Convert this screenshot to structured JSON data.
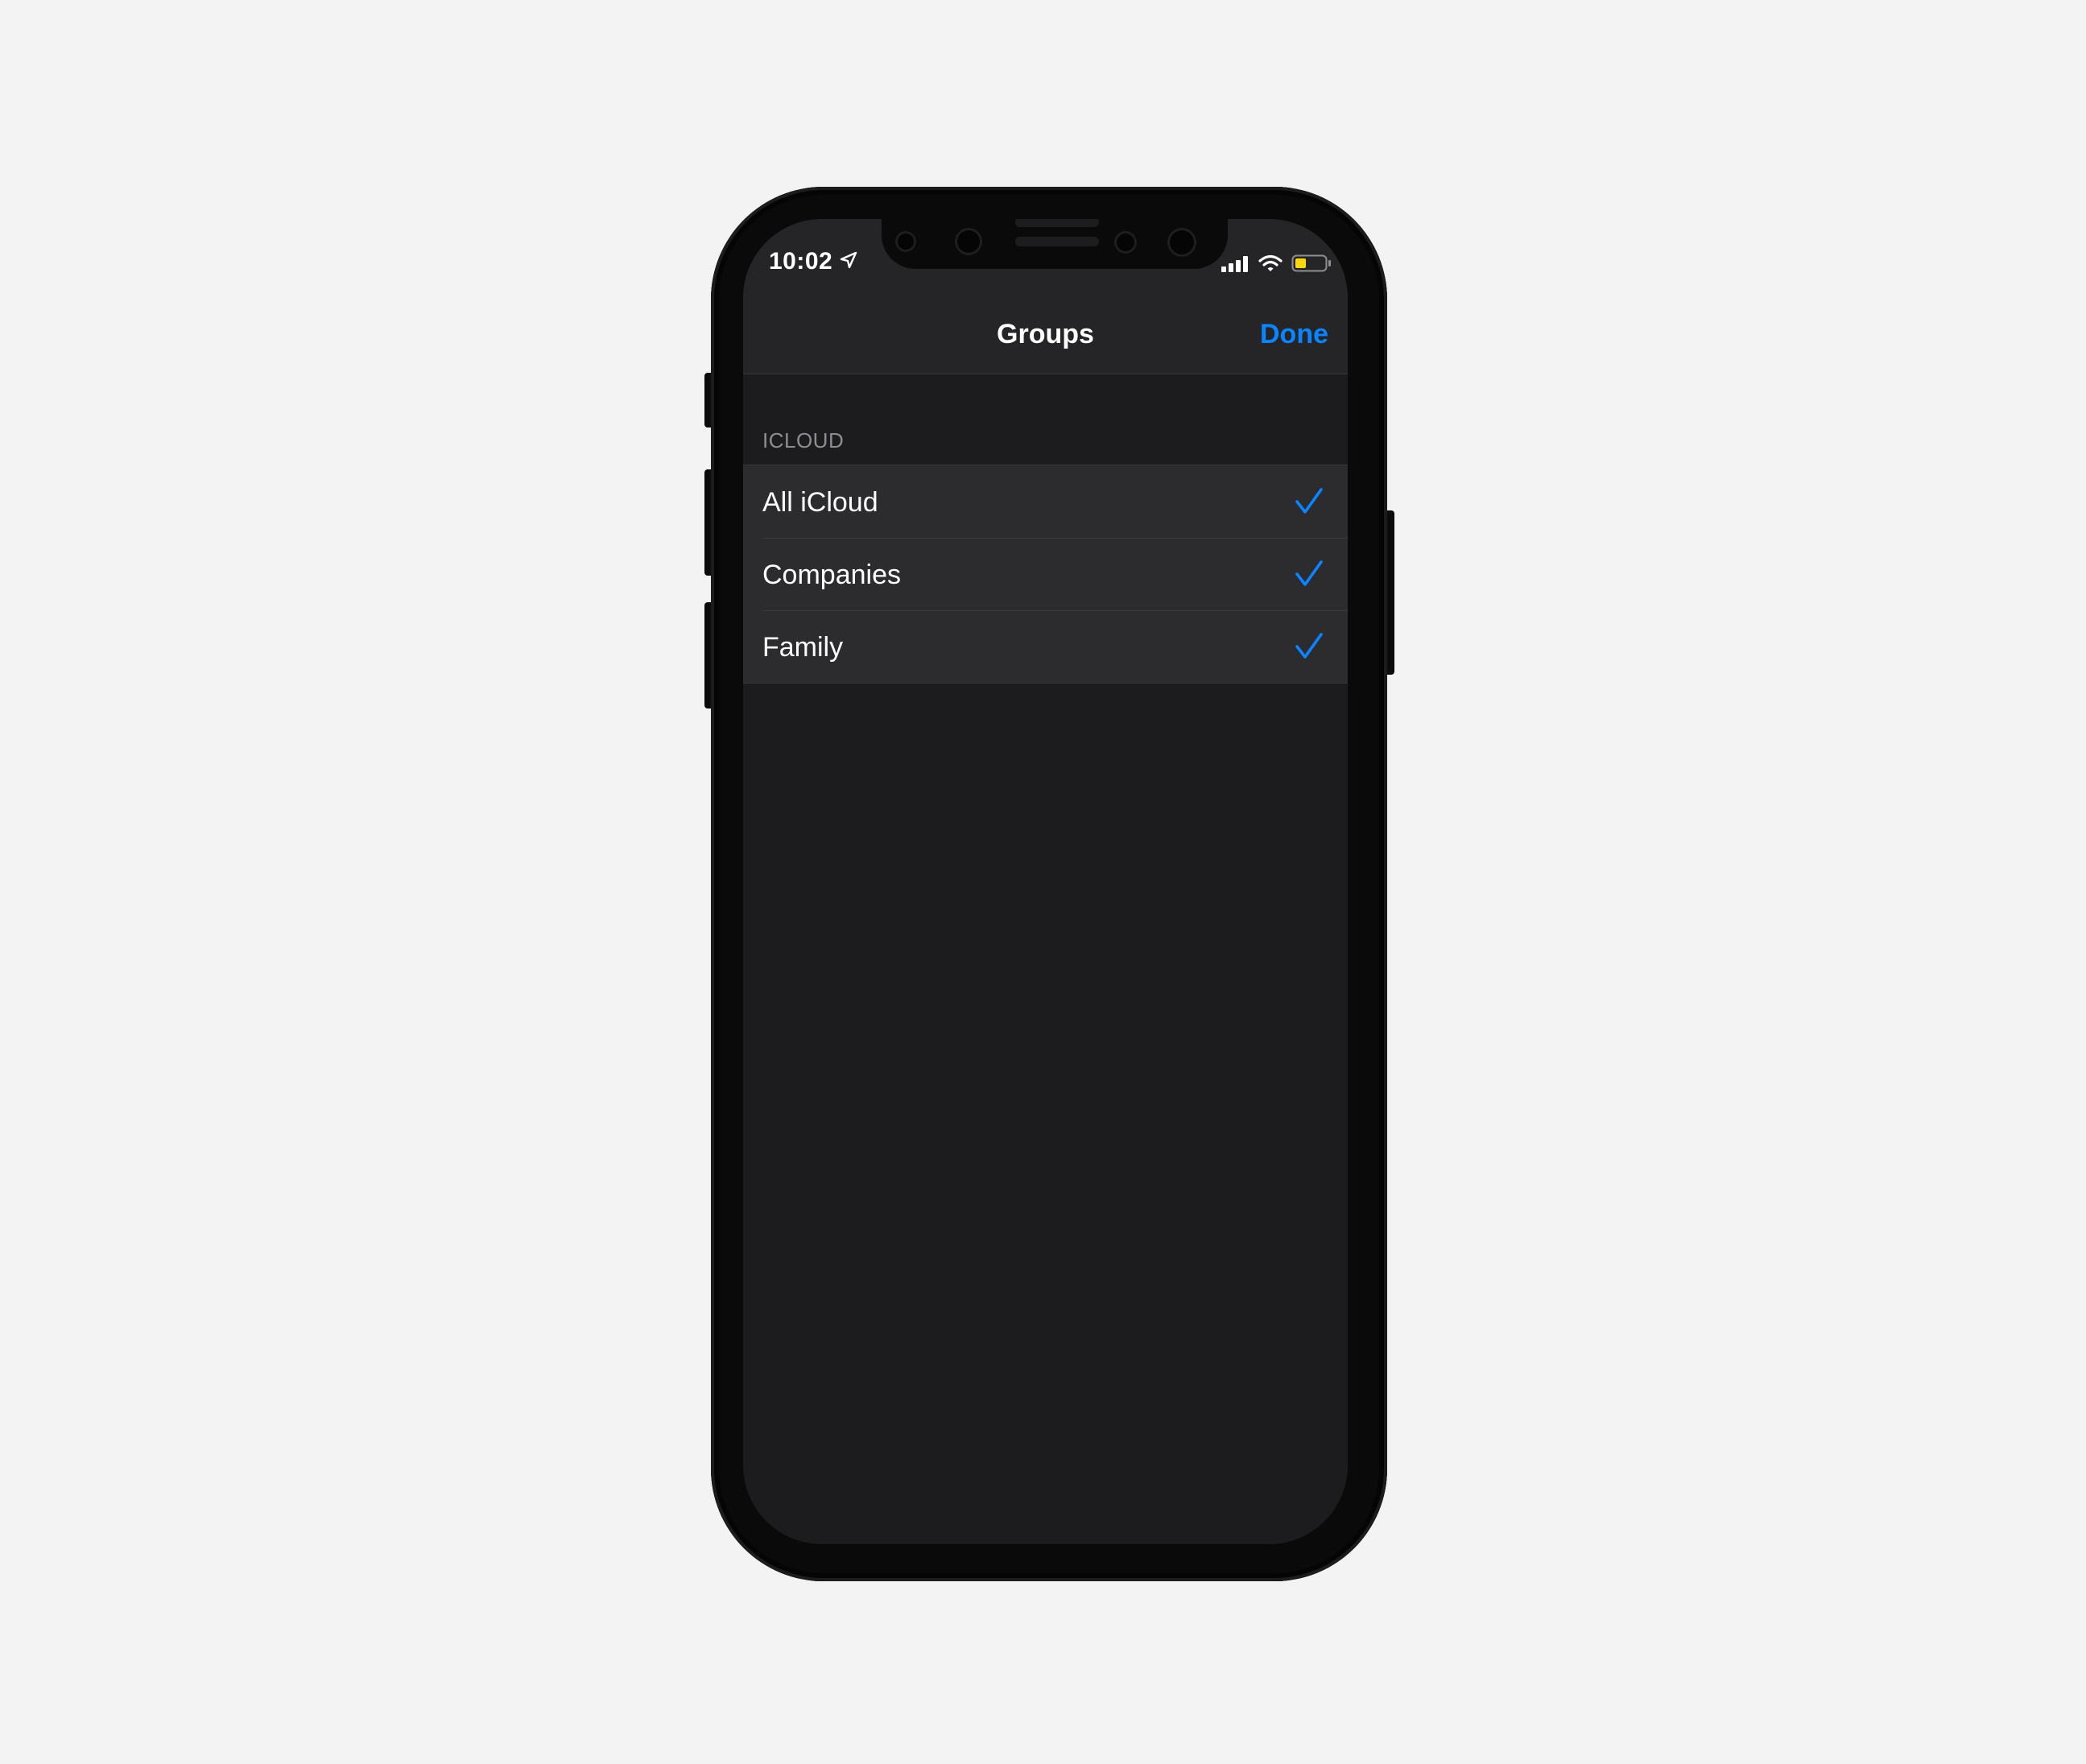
{
  "status_bar": {
    "time": "10:02",
    "icons": [
      "location-arrow-icon",
      "cellular-signal-icon",
      "wifi-icon",
      "battery-icon"
    ]
  },
  "nav": {
    "title": "Groups",
    "done_label": "Done"
  },
  "section": {
    "header": "ICLOUD",
    "items": [
      {
        "label": "All iCloud",
        "checked": true
      },
      {
        "label": "Companies",
        "checked": true
      },
      {
        "label": "Family",
        "checked": true
      }
    ]
  },
  "colors": {
    "accent": "#0a84ff",
    "background": "#1c1c1e",
    "cell": "#2c2c2e",
    "battery_fill": "#ffd60a"
  }
}
